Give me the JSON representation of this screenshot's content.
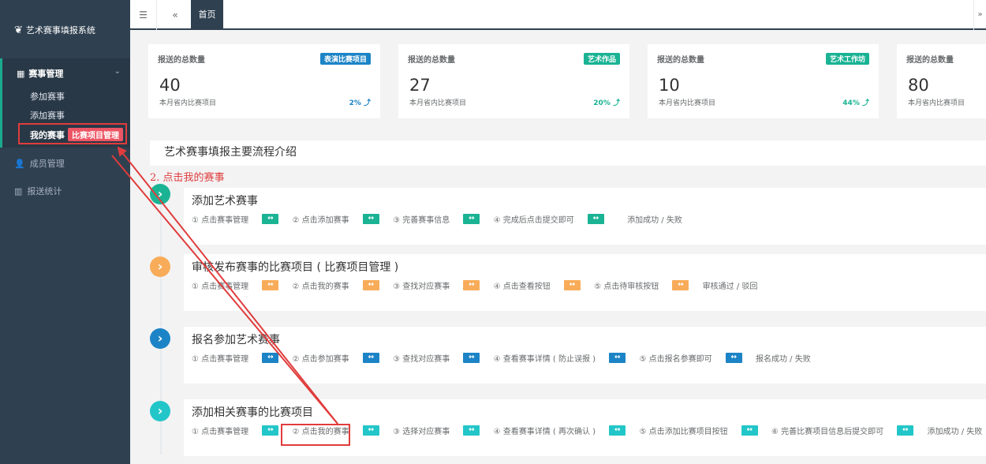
{
  "sidebar": {
    "logo": "艺术赛事填报系统",
    "logo_icon": "wheat-icon",
    "group": "赛事管理",
    "items": [
      {
        "label": "参加赛事"
      },
      {
        "label": "添加赛事"
      },
      {
        "label": "我的赛事",
        "badge": "比赛项目管理"
      }
    ],
    "nav": [
      {
        "label": "成员管理",
        "icon": "user-icon"
      },
      {
        "label": "报送统计",
        "icon": "bar-chart-icon"
      }
    ]
  },
  "topbar": {
    "tab": "首页"
  },
  "stats": [
    {
      "title": "报送的总数量",
      "label": "表演比赛项目",
      "label_color": "#1c84c6",
      "number": "40",
      "sub": "本月省内比赛项目",
      "percent": "2%",
      "percent_color": "#1c84c6"
    },
    {
      "title": "报送的总数量",
      "label": "艺术作品",
      "label_color": "#1ab394",
      "number": "27",
      "sub": "本月省内比赛项目",
      "percent": "20%",
      "percent_color": "#1ab394"
    },
    {
      "title": "报送的总数量",
      "label": "艺术工作坊",
      "label_color": "#1ab394",
      "number": "10",
      "sub": "本月省内比赛项目",
      "percent": "44%",
      "percent_color": "#1ab394"
    },
    {
      "title": "报送的总数量",
      "number": "80",
      "sub": "本月省内比赛项目"
    }
  ],
  "flow_title": "艺术赛事填报主要流程介绍",
  "step_annotation": "2. 点击我的赛事",
  "arrow_symbol": "↔",
  "flows": [
    {
      "title": "添加艺术赛事",
      "color": "#1ab394",
      "steps": [
        "① 点击赛事管理",
        "② 点击添加赛事",
        "③ 完善赛事信息",
        "④ 完成后点击提交即可"
      ],
      "result": "添加成功 / 失败"
    },
    {
      "title": "审核发布赛事的比赛项目 ( 比赛项目管理 )",
      "color": "#f8ac59",
      "steps": [
        "① 点击赛事管理",
        "② 点击我的赛事",
        "③ 查找对应赛事",
        "④ 点击查看按钮",
        "⑤ 点击待审核按钮"
      ],
      "result": "审核通过 / 驳回"
    },
    {
      "title": "报名参加艺术赛事",
      "color": "#1c84c6",
      "steps": [
        "① 点击赛事管理",
        "② 点击参加赛事",
        "③ 查找对应赛事",
        "④ 查看赛事详情 ( 防止误报 )",
        "⑤ 点击报名参赛即可"
      ],
      "result": "报名成功 / 失败"
    },
    {
      "title": "添加相关赛事的比赛项目",
      "color": "#23c6c8",
      "steps": [
        "① 点击赛事管理",
        "② 点击我的赛事",
        "③ 选择对应赛事",
        "④ 查看赛事详情 ( 再次确认 )",
        "⑤ 点击添加比赛项目按钮",
        "⑥ 完善比赛项目信息后提交即可"
      ],
      "result": "添加成功 / 失败"
    }
  ]
}
